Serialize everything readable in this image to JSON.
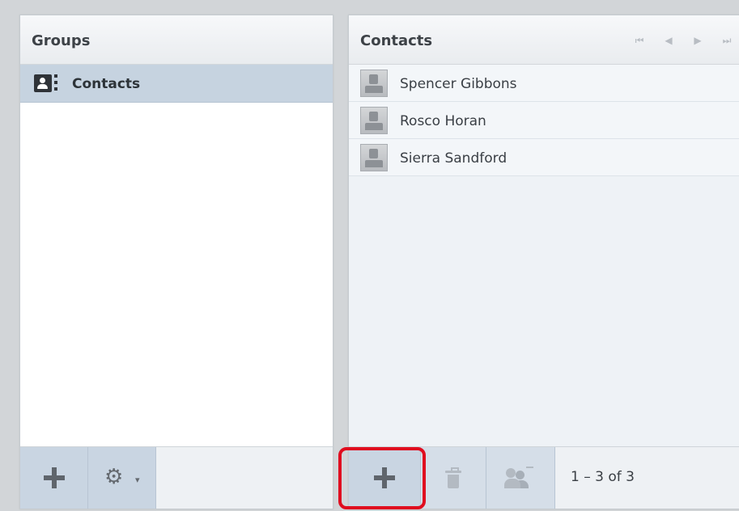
{
  "groups_panel": {
    "title": "Groups",
    "items": [
      {
        "label": "Contacts"
      }
    ]
  },
  "contacts_panel": {
    "title": "Contacts",
    "contacts": [
      {
        "name": "Spencer Gibbons"
      },
      {
        "name": "Rosco Horan"
      },
      {
        "name": "Sierra Sandford"
      }
    ],
    "pager_icons": [
      "first-page-icon",
      "prev-page-icon",
      "next-page-icon",
      "last-page-icon"
    ],
    "count_label": "1 – 3 of 3"
  },
  "colors": {
    "selection": "#c6d3e0",
    "highlight_border": "#e00d1f"
  }
}
